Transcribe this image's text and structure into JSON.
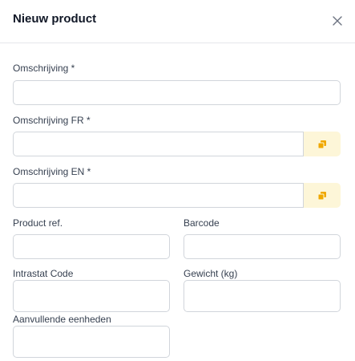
{
  "modal": {
    "title": "Nieuw product",
    "close_icon": "close-icon"
  },
  "form": {
    "omschrijving": {
      "label": "Omschrijving *",
      "value": ""
    },
    "omschrijving_fr": {
      "label": "Omschrijving FR *",
      "value": "",
      "action_icon": "copy-icon"
    },
    "omschrijving_en": {
      "label": "Omschrijving EN *",
      "value": "",
      "action_icon": "copy-icon"
    },
    "product_ref": {
      "label": "Product ref.",
      "value": ""
    },
    "barcode": {
      "label": "Barcode",
      "value": ""
    },
    "intrastat_code": {
      "label": "Intrastat Code",
      "value": ""
    },
    "gewicht": {
      "label": "Gewicht (kg)",
      "value": ""
    },
    "aanvullende_eenheden": {
      "label": "Aanvullende eenheden",
      "value": ""
    }
  },
  "colors": {
    "addon_background": "#fdf6d8",
    "addon_icon": "#f0a800",
    "border": "#d1d5db"
  }
}
